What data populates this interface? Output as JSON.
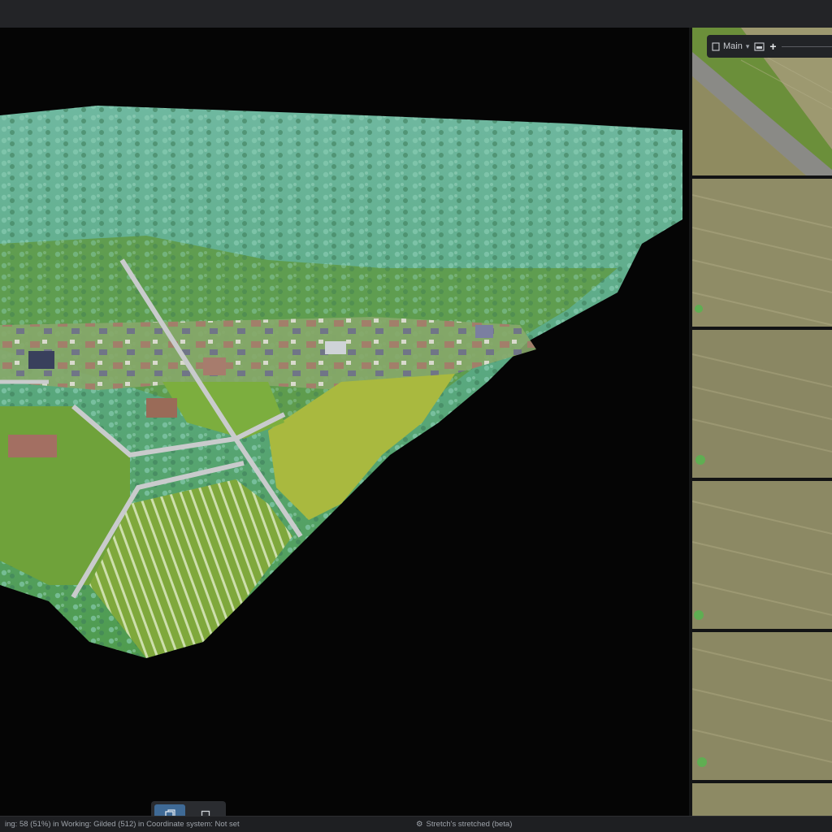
{
  "panel_toolbar": {
    "view_label": "Main",
    "zoom_icon": "plus-icon",
    "image_icon": "image-icon",
    "mode_icon": "document-icon"
  },
  "viewport_toolbar": {
    "buttons": [
      {
        "icon": "orbit-view-icon",
        "active": true
      },
      {
        "icon": "frame-icon",
        "active": false
      }
    ]
  },
  "statusbar": {
    "left_text": "ing: 58 (51%) in   Working: Gilded (512) in   Coordinate system: Not set",
    "mid_text": "Stretch's stretched (beta)"
  },
  "thumbnails": [
    {
      "type": "road-field"
    },
    {
      "type": "field"
    },
    {
      "type": "field"
    },
    {
      "type": "field"
    },
    {
      "type": "field"
    },
    {
      "type": "field"
    }
  ],
  "colors": {
    "viewport_bg": "#050505",
    "panel_bg": "#121314",
    "accent": "#3f6a96",
    "field": "#8d8a63",
    "grass": "#6c9a3a"
  }
}
